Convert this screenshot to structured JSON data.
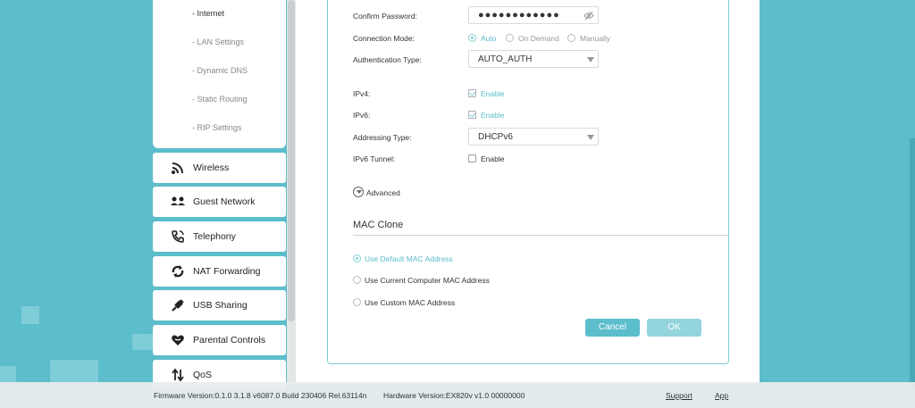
{
  "sidebar": {
    "sub_items": [
      {
        "label": "- Internet",
        "active": true
      },
      {
        "label": "- LAN Settings"
      },
      {
        "label": "- Dynamic DNS"
      },
      {
        "label": "- Static Routing"
      },
      {
        "label": "- RIP Settings"
      }
    ],
    "menu": [
      {
        "label": "Wireless",
        "icon": "wifi-icon"
      },
      {
        "label": "Guest Network",
        "icon": "guest-network-icon"
      },
      {
        "label": "Telephony",
        "icon": "phone-icon"
      },
      {
        "label": "NAT Forwarding",
        "icon": "nat-forwarding-icon"
      },
      {
        "label": "USB Sharing",
        "icon": "usb-icon"
      },
      {
        "label": "Parental Controls",
        "icon": "heart-icon"
      },
      {
        "label": "QoS",
        "icon": "qos-arrows-icon"
      }
    ]
  },
  "form": {
    "confirm_password": {
      "label": "Confirm Password:",
      "value": "●●●●●●●●●●●●"
    },
    "connection_mode": {
      "label": "Connection Mode:",
      "options": [
        "Auto",
        "On Demand",
        "Manually"
      ],
      "selected": "Auto"
    },
    "auth_type": {
      "label": "Authentication Type:",
      "value": "AUTO_AUTH"
    },
    "ipv4": {
      "label": "IPv4:",
      "checkbox_label": "Enable",
      "checked": true
    },
    "ipv6": {
      "label": "IPv6:",
      "checkbox_label": "Enable",
      "checked": true
    },
    "addressing_type": {
      "label": "Addressing Type:",
      "value": "DHCPv6"
    },
    "ipv6_tunnel": {
      "label": "IPv6 Tunnel:",
      "checkbox_label": "Enable",
      "checked": false
    },
    "advanced_label": "Advanced"
  },
  "mac_clone": {
    "title": "MAC Clone",
    "options": [
      "Use Default MAC Address",
      "Use Current Computer MAC Address",
      "Use Custom MAC Address"
    ],
    "selected": "Use Default MAC Address"
  },
  "buttons": {
    "cancel": "Cancel",
    "ok": "OK"
  },
  "footer": {
    "firmware": "Firmware Version:0.1.0 3.1.8 v6087.0 Build 230406 Rel.63114n",
    "hardware": "Hardware Version:EX820v v1.0 00000000",
    "support": "Support",
    "app": "App"
  },
  "colors": {
    "background": "#5cbdcb",
    "accent": "#5bbccb",
    "ok_button": "#93d4dd"
  }
}
